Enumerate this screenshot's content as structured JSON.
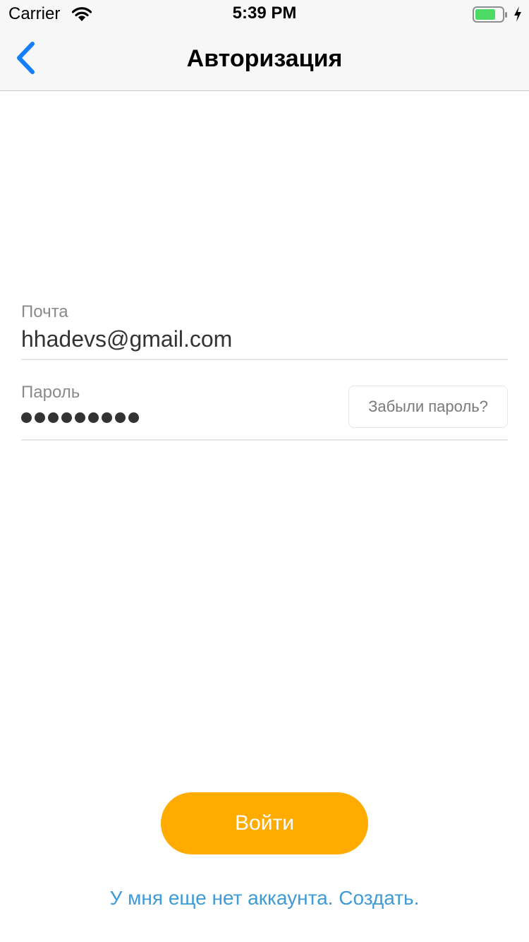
{
  "status_bar": {
    "carrier": "Carrier",
    "time": "5:39 PM",
    "battery_color": "#4cd964"
  },
  "nav": {
    "title": "Авторизация",
    "accent_color": "#157efb"
  },
  "form": {
    "email": {
      "label": "Почта",
      "value": "hhadevs@gmail.com"
    },
    "password": {
      "label": "Пароль",
      "masked_length": 9,
      "forgot_label": "Забыли пароль?"
    }
  },
  "actions": {
    "login_label": "Войти",
    "login_color": "#ffab00",
    "signup_label": "У мня еще нет аккаунта. Создать.",
    "signup_color": "#3f9ad6"
  }
}
